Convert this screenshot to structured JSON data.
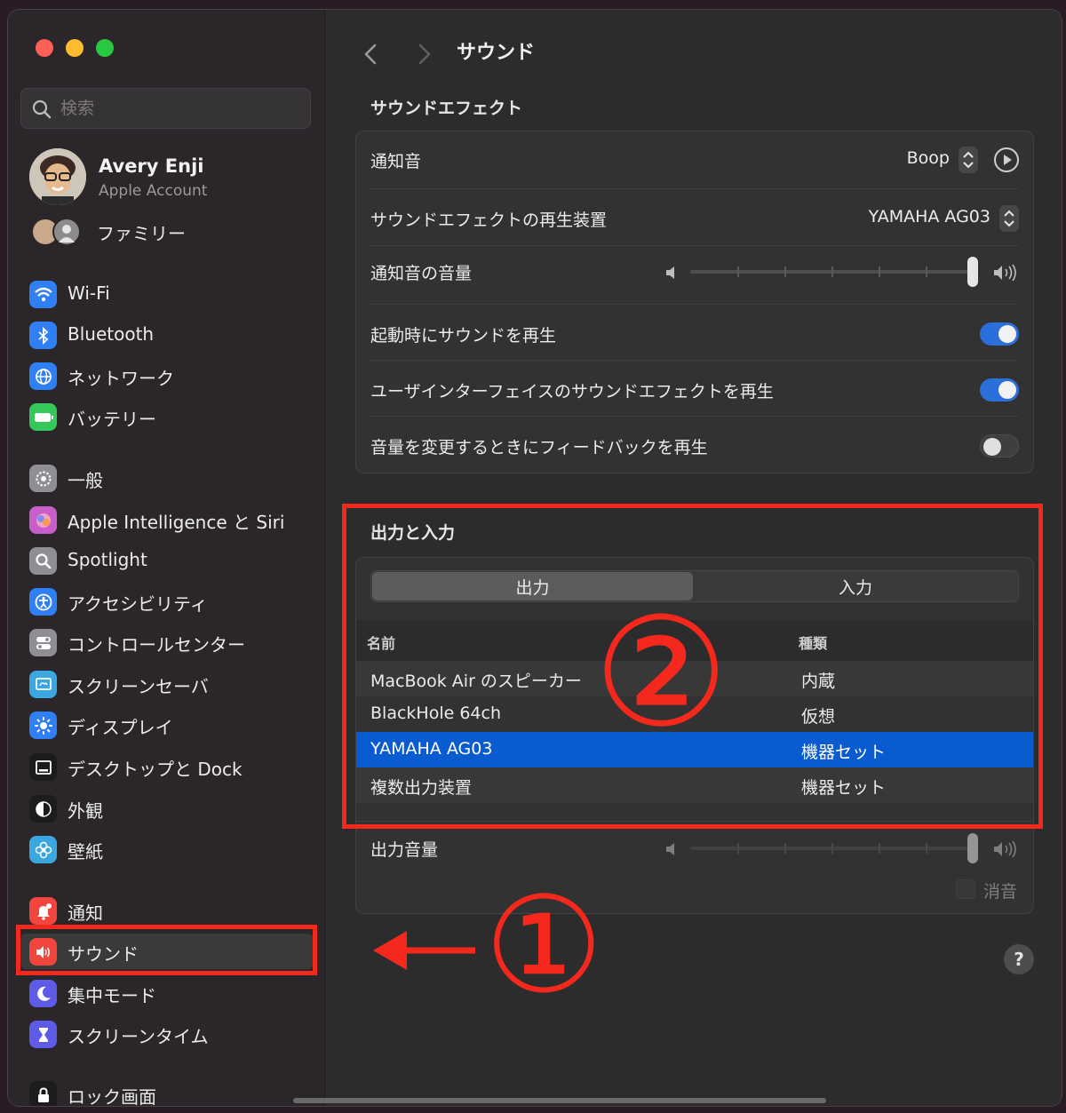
{
  "sidebar": {
    "search_placeholder": "検索",
    "account": {
      "name": "Avery Enji",
      "subtitle": "Apple Account"
    },
    "family_label": "ファミリー",
    "items": [
      {
        "label": "Wi-Fi",
        "icon": "wifi-icon",
        "color": "#2f7ff5"
      },
      {
        "label": "Bluetooth",
        "icon": "bluetooth-icon",
        "color": "#2f7ff5"
      },
      {
        "label": "ネットワーク",
        "icon": "globe-icon",
        "color": "#2f7ff5"
      },
      {
        "label": "バッテリー",
        "icon": "battery-icon",
        "color": "#34c759"
      },
      {
        "label": "一般",
        "icon": "gear-icon",
        "color": "#8e8e93"
      },
      {
        "label": "Apple Intelligence と Siri",
        "icon": "siri-icon",
        "color": "#c85ec9"
      },
      {
        "label": "Spotlight",
        "icon": "magnifier-icon",
        "color": "#8e8e93"
      },
      {
        "label": "アクセシビリティ",
        "icon": "accessibility-icon",
        "color": "#2f7ff5"
      },
      {
        "label": "コントロールセンター",
        "icon": "control-center-icon",
        "color": "#8e8e93"
      },
      {
        "label": "スクリーンセーバ",
        "icon": "screensaver-icon",
        "color": "#3aa7e0"
      },
      {
        "label": "ディスプレイ",
        "icon": "sun-icon",
        "color": "#2f7ff5"
      },
      {
        "label": "デスクトップと Dock",
        "icon": "dock-icon",
        "color": "#1c1c1e"
      },
      {
        "label": "外観",
        "icon": "appearance-icon",
        "color": "#1c1c1e"
      },
      {
        "label": "壁紙",
        "icon": "flower-icon",
        "color": "#3aa7e0"
      },
      {
        "label": "通知",
        "icon": "bell-icon",
        "color": "#f2453d"
      },
      {
        "label": "サウンド",
        "icon": "speaker-icon",
        "color": "#f2453d",
        "selected": true
      },
      {
        "label": "集中モード",
        "icon": "moon-icon",
        "color": "#5e5ce6"
      },
      {
        "label": "スクリーンタイム",
        "icon": "hourglass-icon",
        "color": "#5e5ce6"
      },
      {
        "label": "ロック画面",
        "icon": "lock-icon",
        "color": "#1c1c1e"
      }
    ]
  },
  "main": {
    "title": "サウンド",
    "effects": {
      "section_title": "サウンドエフェクト",
      "alert_sound_label": "通知音",
      "alert_sound_value": "Boop",
      "output_device_label": "サウンドエフェクトの再生装置",
      "output_device_value": "YAMAHA AG03",
      "alert_volume_label": "通知音の音量",
      "alert_volume_level": 1.0,
      "startup_sound_label": "起動時にサウンドを再生",
      "startup_sound_on": true,
      "ui_sound_label": "ユーザインターフェイスのサウンドエフェクトを再生",
      "ui_sound_on": true,
      "feedback_label": "音量を変更するときにフィードバックを再生",
      "feedback_on": false
    },
    "io": {
      "section_title": "出力と入力",
      "tabs": [
        "出力",
        "入力"
      ],
      "active_tab": 0,
      "columns": [
        "名前",
        "種類"
      ],
      "devices": [
        {
          "name": "MacBook Air のスピーカー",
          "type": "内蔵"
        },
        {
          "name": "BlackHole 64ch",
          "type": "仮想"
        },
        {
          "name": "YAMAHA AG03",
          "type": "機器セット",
          "selected": true
        },
        {
          "name": "複数出力装置",
          "type": "機器セット"
        }
      ],
      "output_volume_label": "出力音量",
      "output_volume_level": 1.0,
      "mute_label": "消音"
    },
    "help_label": "?"
  },
  "annotations": {
    "marker1": "①",
    "marker2": "②",
    "color": "#f4281c"
  },
  "colors": {
    "accent": "#2a6fda",
    "selection": "#0b5bd0"
  }
}
